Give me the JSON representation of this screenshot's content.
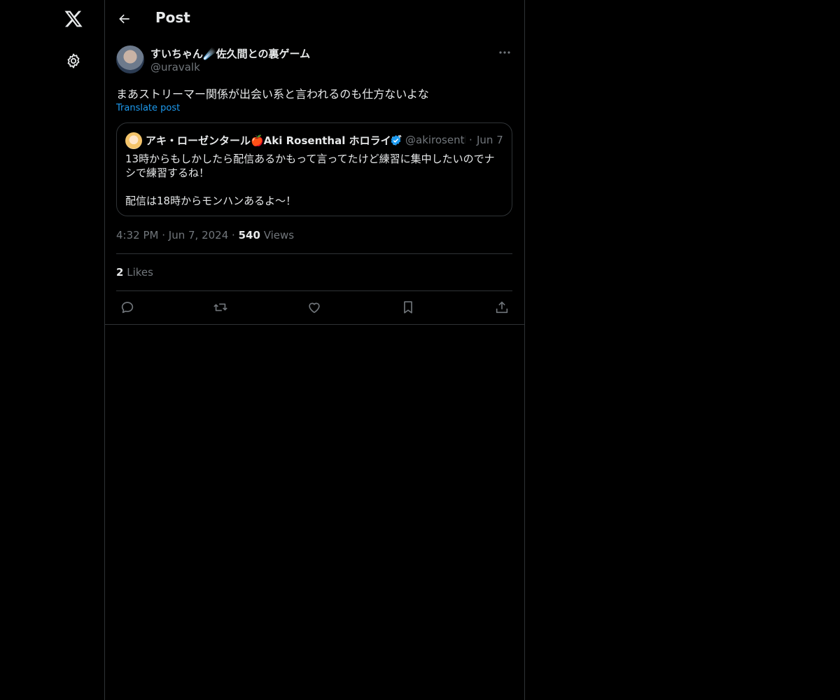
{
  "nav": {
    "logo_icon": "x-logo-icon",
    "settings_icon": "gear-icon"
  },
  "header": {
    "title": "Post",
    "back_icon": "arrow-left-icon"
  },
  "post": {
    "display_name": "すいちゃん☄️佐久間との裏ゲーム",
    "handle": "@uravalk",
    "text": "まあストリーマー関係が出会い系と言われるのも仕方ないよな",
    "translate_label": "Translate post",
    "quote": {
      "display_name": "アキ・ローゼンタール🍎Aki Rosenthal ホロライブ",
      "verified": true,
      "handle": "@akirosenthal",
      "separator": "·",
      "date": "Jun 7",
      "text_line1": "13時からもしかしたら配信あるかもって言ってたけど練習に集中したいのでナシで練習するね！",
      "text_line2": "配信は18時からモンハンあるよ〜！"
    },
    "time": "4:32 PM",
    "separator": "·",
    "date": "Jun 7, 2024",
    "views_count": "540",
    "views_label": "Views",
    "likes_count": "2",
    "likes_label": "Likes"
  },
  "actions": [
    {
      "icon": "reply-icon"
    },
    {
      "icon": "repost-icon"
    },
    {
      "icon": "like-icon"
    },
    {
      "icon": "bookmark-icon"
    },
    {
      "icon": "share-icon"
    }
  ],
  "colors": {
    "background": "#000000",
    "text": "#e7e9ea",
    "muted": "#71767b",
    "accent": "#1d9bf0",
    "border": "#2f3336"
  }
}
